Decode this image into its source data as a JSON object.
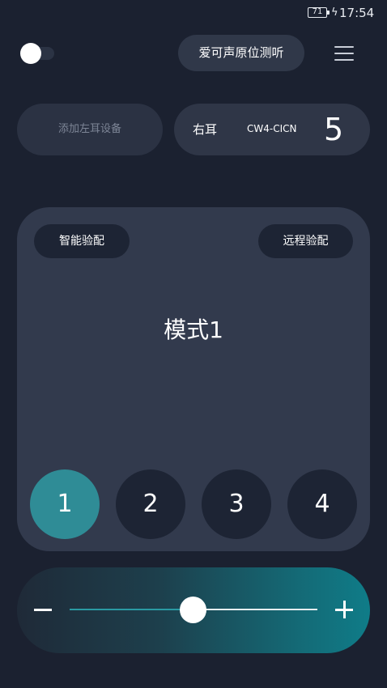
{
  "status_bar": {
    "battery": "71",
    "charging_icon": "lightning-icon",
    "time": "17:54"
  },
  "header": {
    "toggle_on": false,
    "test_button": "爱可声原位测听",
    "menu_icon": "hamburger-menu-icon"
  },
  "devices": {
    "left_placeholder": "添加左耳设备",
    "right_label": "右耳",
    "right_model": "CW4-CICN",
    "right_value": "5"
  },
  "panel": {
    "smart_fit": "智能验配",
    "remote_fit": "远程验配",
    "mode_title": "模式1",
    "modes": [
      "1",
      "2",
      "3",
      "4"
    ],
    "active_mode": "1"
  },
  "volume": {
    "minus_icon": "minus-icon",
    "plus_icon": "plus-icon",
    "level": 0.5
  },
  "colors": {
    "background": "#1b2130",
    "accent": "#2f8c96",
    "panel": "#323a4d"
  }
}
